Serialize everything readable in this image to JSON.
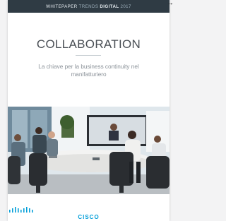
{
  "header": {
    "segment1": "WHITEPAPER",
    "segment2": "TRENDS",
    "segment3": "DIGITAL",
    "segment4": "2017"
  },
  "cover": {
    "title": "COLLABORATION",
    "subtitle": "La chiave per la business continuity nel manifatturiero"
  },
  "footer": {
    "brand": "CISCO"
  },
  "icons": {
    "corner": "arrow-icon",
    "logo": "cisco-logo-icon"
  },
  "colors": {
    "topbar": "#2f3b44",
    "brand": "#049fd9"
  }
}
